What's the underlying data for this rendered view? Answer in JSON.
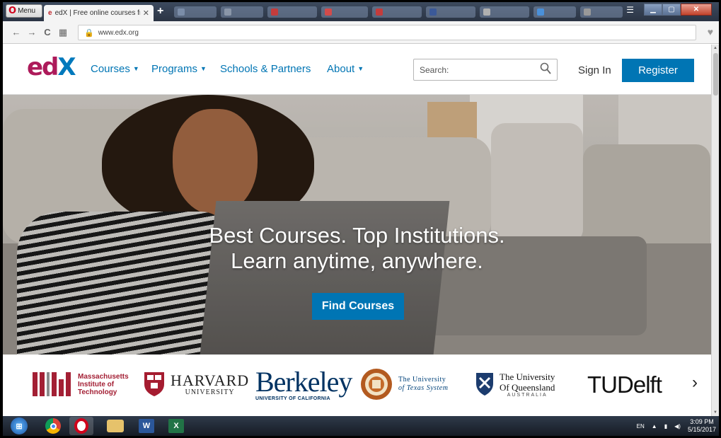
{
  "browser": {
    "menu_label": "Menu",
    "tab_title": "edX | Free online courses fr",
    "url": "www.edx.org"
  },
  "header": {
    "logo_part1": "ed",
    "logo_part2": "X",
    "nav": [
      {
        "label": "Courses",
        "has_caret": true
      },
      {
        "label": "Programs",
        "has_caret": true
      },
      {
        "label": "Schools & Partners",
        "has_caret": false
      },
      {
        "label": "About",
        "has_caret": true
      }
    ],
    "search_placeholder": "Search:",
    "sign_in": "Sign In",
    "register": "Register"
  },
  "hero": {
    "line1": "Best Courses. Top Institutions.",
    "line2": "Learn anytime, anywhere.",
    "cta": "Find Courses"
  },
  "partners": {
    "mit": [
      "Massachusetts",
      "Institute of",
      "Technology"
    ],
    "harvard_name": "HARVARD",
    "harvard_sub": "UNIVERSITY",
    "berkeley_name": "Berkeley",
    "berkeley_sub": "UNIVERSITY OF CALIFORNIA",
    "ut": [
      "The University",
      "of Texas System"
    ],
    "uq": [
      "The University",
      "Of Queensland"
    ],
    "uq_sub": "AUSTRALIA",
    "tudelft": "UDelft",
    "tudelft_t": "T"
  },
  "taskbar": {
    "lang": "EN",
    "time": "3:09 PM",
    "date": "5/15/2017"
  },
  "colors": {
    "edx_blue": "#0075b4",
    "edx_magenta": "#ad1a5a",
    "mit_red": "#a31f34"
  }
}
